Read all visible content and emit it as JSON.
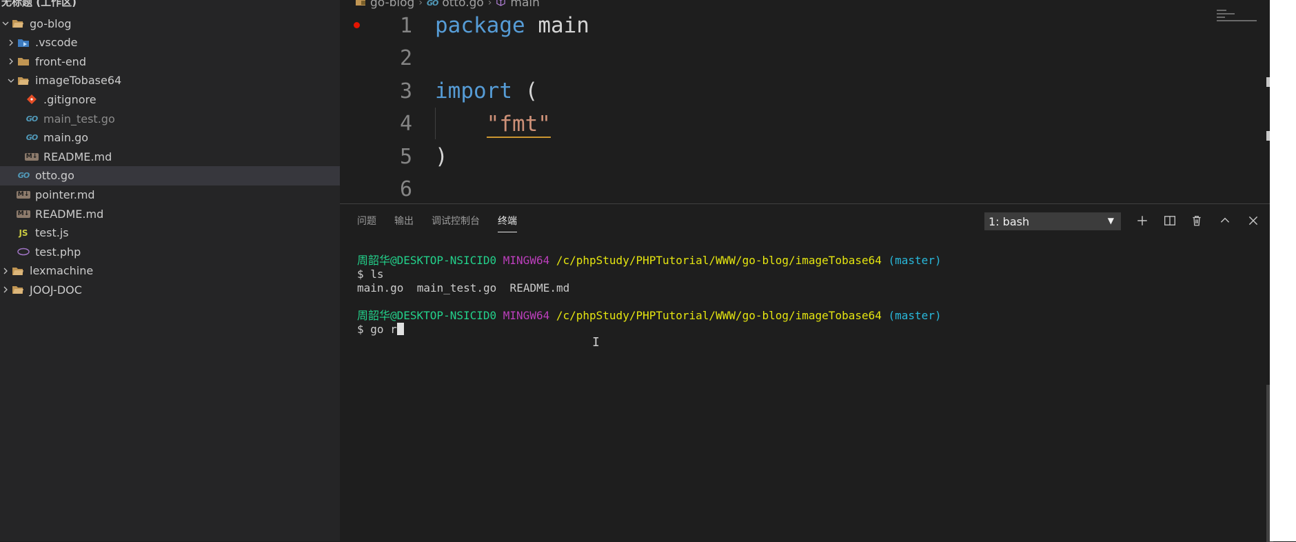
{
  "sidebar": {
    "title": "无标题 (工作区)",
    "items": [
      {
        "label": "go-blog",
        "depth": 0,
        "chevron": "down",
        "icon": "folder-open-icon"
      },
      {
        "label": ".vscode",
        "depth": 1,
        "chevron": "right",
        "icon": "vscode-folder-icon"
      },
      {
        "label": "front-end",
        "depth": 1,
        "chevron": "right",
        "icon": "folder-icon"
      },
      {
        "label": "imageTobase64",
        "depth": 1,
        "chevron": "down",
        "icon": "folder-open-icon"
      },
      {
        "label": ".gitignore",
        "depth": 2,
        "icon": "git-icon"
      },
      {
        "label": "main_test.go",
        "depth": 2,
        "icon": "go-file-icon",
        "dim": true
      },
      {
        "label": "main.go",
        "depth": 2,
        "icon": "go-file-icon"
      },
      {
        "label": "README.md",
        "depth": 2,
        "icon": "markdown-icon"
      },
      {
        "label": "otto.go",
        "depth": 1,
        "icon": "go-file-icon",
        "selected": true
      },
      {
        "label": "pointer.md",
        "depth": 1,
        "icon": "markdown-icon"
      },
      {
        "label": "README.md",
        "depth": 1,
        "icon": "markdown-icon"
      },
      {
        "label": "test.js",
        "depth": 1,
        "icon": "js-file-icon"
      },
      {
        "label": "test.php",
        "depth": 1,
        "icon": "php-file-icon"
      },
      {
        "label": "lexmachine",
        "depth": 0,
        "chevron": "right",
        "icon": "folder-open-icon"
      },
      {
        "label": "JOOJ-DOC",
        "depth": 0,
        "chevron": "right",
        "icon": "folder-open-icon"
      }
    ]
  },
  "editor": {
    "breadcrumb": [
      "go-blog",
      "otto.go",
      "main"
    ],
    "lines": [
      {
        "num": "1",
        "tokens": [
          {
            "t": "package",
            "c": "kw"
          },
          {
            "t": " main",
            "c": "id"
          }
        ]
      },
      {
        "num": "2",
        "tokens": []
      },
      {
        "num": "3",
        "tokens": [
          {
            "t": "import",
            "c": "kw"
          },
          {
            "t": " (",
            "c": "id"
          }
        ]
      },
      {
        "num": "4",
        "tokens": [
          {
            "t": "    ",
            "c": "id"
          },
          {
            "t": "\"fmt\"",
            "c": "str"
          }
        ]
      },
      {
        "num": "5",
        "tokens": [
          {
            "t": ")",
            "c": "id"
          }
        ]
      },
      {
        "num": "6",
        "tokens": []
      }
    ]
  },
  "panel": {
    "tabs": [
      "问题",
      "输出",
      "调试控制台",
      "终端"
    ],
    "active_tab": 3,
    "terminal_select": "1: bash",
    "terminal": {
      "prompt_user": "周韶华@DESKTOP-NSICID0",
      "prompt_env": "MINGW64",
      "prompt_path": "/c/phpStudy/PHPTutorial/WWW/go-blog/imageTobase64",
      "prompt_branch": "(master)",
      "cmd1": "$ ls",
      "out1": "main.go  main_test.go  README.md",
      "cmd2": "$ go r"
    }
  },
  "colors": {
    "accent_blue": "#569cd6",
    "string": "#ce9178",
    "terminal_green": "#23d18b",
    "terminal_magenta": "#bc3fbc",
    "terminal_yellow": "#e5e510",
    "terminal_cyan": "#29b8db"
  }
}
